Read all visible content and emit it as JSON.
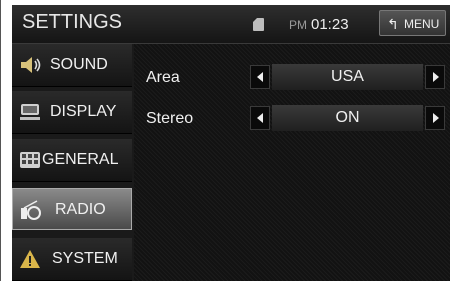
{
  "header": {
    "title": "SETTINGS",
    "ampm": "PM",
    "time": "01:23",
    "menu_label": "MENU"
  },
  "sidebar": {
    "items": [
      {
        "label": "SOUND",
        "icon": "speaker-icon"
      },
      {
        "label": "DISPLAY",
        "icon": "display-icon"
      },
      {
        "label": "GENERAL",
        "icon": "general-icon"
      },
      {
        "label": "RADIO",
        "icon": "radio-icon",
        "active": true
      },
      {
        "label": "SYSTEM",
        "icon": "warning-icon"
      }
    ]
  },
  "settings": [
    {
      "label": "Area",
      "value": "USA"
    },
    {
      "label": "Stereo",
      "value": "ON"
    }
  ]
}
